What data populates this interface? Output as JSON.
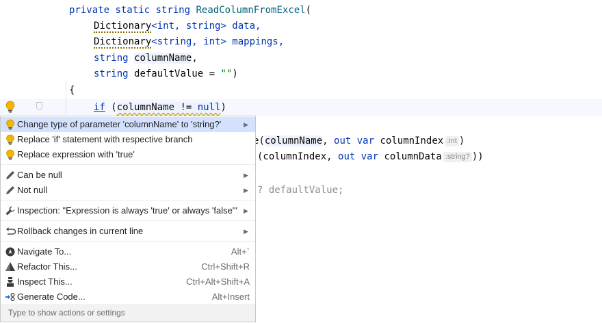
{
  "editor": {
    "line1": {
      "kw1": "private",
      "kw2": "static",
      "kw3": "string",
      "fn": "ReadColumnFromExcel",
      "rest": "("
    },
    "line2": {
      "type": "Dictionary",
      "generic": "<int, string> data,"
    },
    "line3": {
      "type": "Dictionary",
      "generic": "<string, int> mappings,"
    },
    "line4": {
      "kw": "string",
      "param": "columnName",
      "rest": ","
    },
    "line5": {
      "kw": "string",
      "text": "defaultValue = ",
      "str": "\"\"",
      "rest": ")"
    },
    "line6": {
      "text": "{"
    },
    "line7": {
      "kw": "if",
      "open": "(",
      "param": "columnName",
      "op": " != ",
      "kw2": "null",
      "close": ")"
    },
    "line8": {
      "pre": "e(",
      "param": "columnName",
      "sep": ", ",
      "kw1": "out",
      "kw2": "var",
      "var": "columnIndex",
      "hint": ":int",
      "close": ")"
    },
    "line9": {
      "pre": "(columnIndex, ",
      "kw1": "out",
      "kw2": "var",
      "var": "columnData",
      "hint": ":string?",
      "close": "))"
    },
    "line10": {
      "pre": "? defaultValue;"
    }
  },
  "menu": {
    "items": [
      {
        "label": "Change type of parameter 'columnName' to 'string?'",
        "icon": "lightbulb-icon",
        "submenu": true,
        "selected": true
      },
      {
        "label": "Replace 'if' statement with respective branch",
        "icon": "lightbulb-icon"
      },
      {
        "label": "Replace expression with 'true'",
        "icon": "lightbulb-icon"
      },
      {
        "label": "Can be null",
        "icon": "pencil-icon",
        "submenu": true
      },
      {
        "label": "Not null",
        "icon": "pencil-icon",
        "submenu": true
      },
      {
        "label": "Inspection: \"Expression is always 'true' or always 'false'\"",
        "icon": "wrench-icon",
        "submenu": true
      },
      {
        "label": "Rollback changes in current line",
        "icon": "rollback-icon",
        "submenu": true
      },
      {
        "label": "Navigate To...",
        "icon": "navigate-icon",
        "shortcut": "Alt+`"
      },
      {
        "label": "Refactor This...",
        "icon": "refactor-icon",
        "shortcut": "Ctrl+Shift+R"
      },
      {
        "label": "Inspect This...",
        "icon": "inspect-icon",
        "shortcut": "Ctrl+Alt+Shift+A"
      },
      {
        "label": "Generate Code...",
        "icon": "generate-icon",
        "shortcut": "Alt+Insert"
      }
    ],
    "footer": "Type to show actions or settings"
  },
  "colors": {
    "keyword": "#0033b3",
    "method": "#00627a",
    "string": "#067d17",
    "selection": "#d4e2ff",
    "bulb": "#f4b400"
  }
}
